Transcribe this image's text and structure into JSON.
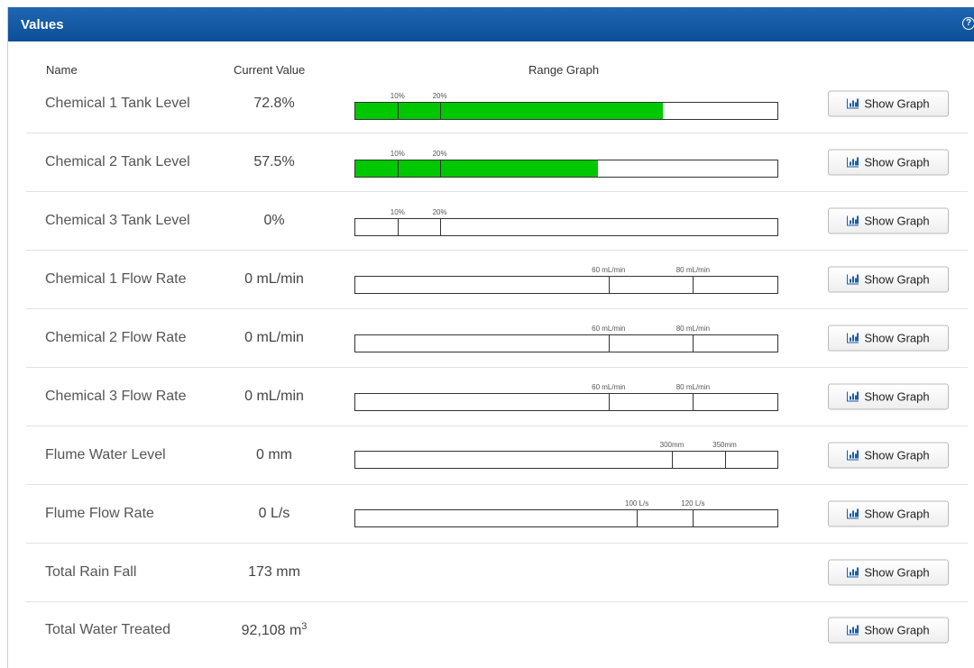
{
  "panel": {
    "title": "Values",
    "help_icon": "?"
  },
  "columns": {
    "name": "Name",
    "current_value": "Current Value",
    "range_graph": "Range Graph"
  },
  "button_label": "Show Graph",
  "colors": {
    "header": "#0c4f98",
    "fill": "#00c800"
  },
  "rows": [
    {
      "name": "Chemical 1 Tank Level",
      "value": "72.8%",
      "fill_fraction": 0.728,
      "thresholds": [
        {
          "label": "10%",
          "fraction": 0.1
        },
        {
          "label": "20%",
          "fraction": 0.2
        }
      ]
    },
    {
      "name": "Chemical 2 Tank Level",
      "value": "57.5%",
      "fill_fraction": 0.575,
      "thresholds": [
        {
          "label": "10%",
          "fraction": 0.1
        },
        {
          "label": "20%",
          "fraction": 0.2
        }
      ]
    },
    {
      "name": "Chemical 3 Tank Level",
      "value": "0%",
      "fill_fraction": 0,
      "thresholds": [
        {
          "label": "10%",
          "fraction": 0.1
        },
        {
          "label": "20%",
          "fraction": 0.2
        }
      ]
    },
    {
      "name": "Chemical 1 Flow Rate",
      "value": "0 mL/min",
      "fill_fraction": 0,
      "thresholds": [
        {
          "label": "60 mL/min",
          "fraction": 0.6
        },
        {
          "label": "80 mL/min",
          "fraction": 0.8
        }
      ]
    },
    {
      "name": "Chemical 2 Flow Rate",
      "value": "0 mL/min",
      "fill_fraction": 0,
      "thresholds": [
        {
          "label": "60 mL/min",
          "fraction": 0.6
        },
        {
          "label": "80 mL/min",
          "fraction": 0.8
        }
      ]
    },
    {
      "name": "Chemical 3 Flow Rate",
      "value": "0 mL/min",
      "fill_fraction": 0,
      "thresholds": [
        {
          "label": "60 mL/min",
          "fraction": 0.6
        },
        {
          "label": "80 mL/min",
          "fraction": 0.8
        }
      ]
    },
    {
      "name": "Flume Water Level",
      "value": "0 mm",
      "fill_fraction": 0,
      "thresholds": [
        {
          "label": "300mm",
          "fraction": 0.75
        },
        {
          "label": "350mm",
          "fraction": 0.875
        }
      ]
    },
    {
      "name": "Flume Flow Rate",
      "value": "0 L/s",
      "fill_fraction": 0,
      "thresholds": [
        {
          "label": "100 L/s",
          "fraction": 0.667
        },
        {
          "label": "120 L/s",
          "fraction": 0.8
        }
      ]
    },
    {
      "name": "Total Rain Fall",
      "value": "173 mm",
      "fill_fraction": null,
      "thresholds": []
    },
    {
      "name": "Total Water Treated",
      "value": "92,108 m",
      "value_sup": "3",
      "fill_fraction": null,
      "thresholds": []
    }
  ]
}
